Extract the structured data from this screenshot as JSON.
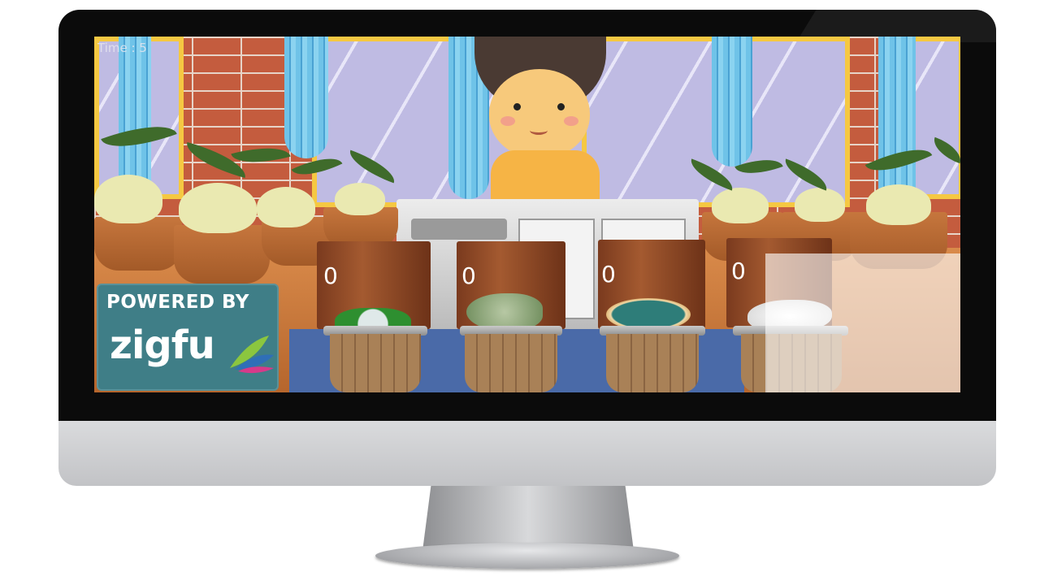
{
  "hud": {
    "time_label": "Time : 5"
  },
  "bins": [
    {
      "score": "0",
      "contents": "cans"
    },
    {
      "score": "0",
      "contents": "leaves"
    },
    {
      "score": "0",
      "contents": "plate"
    },
    {
      "score": "0",
      "contents": "paper"
    }
  ],
  "badge": {
    "powered_by": "POWERED BY",
    "logo": "zigfu"
  },
  "colors": {
    "badge_bg": "#3f7e87",
    "wall": "#c45c3e",
    "window_frame": "#f5c842",
    "curtain": "#6fc3e8"
  }
}
